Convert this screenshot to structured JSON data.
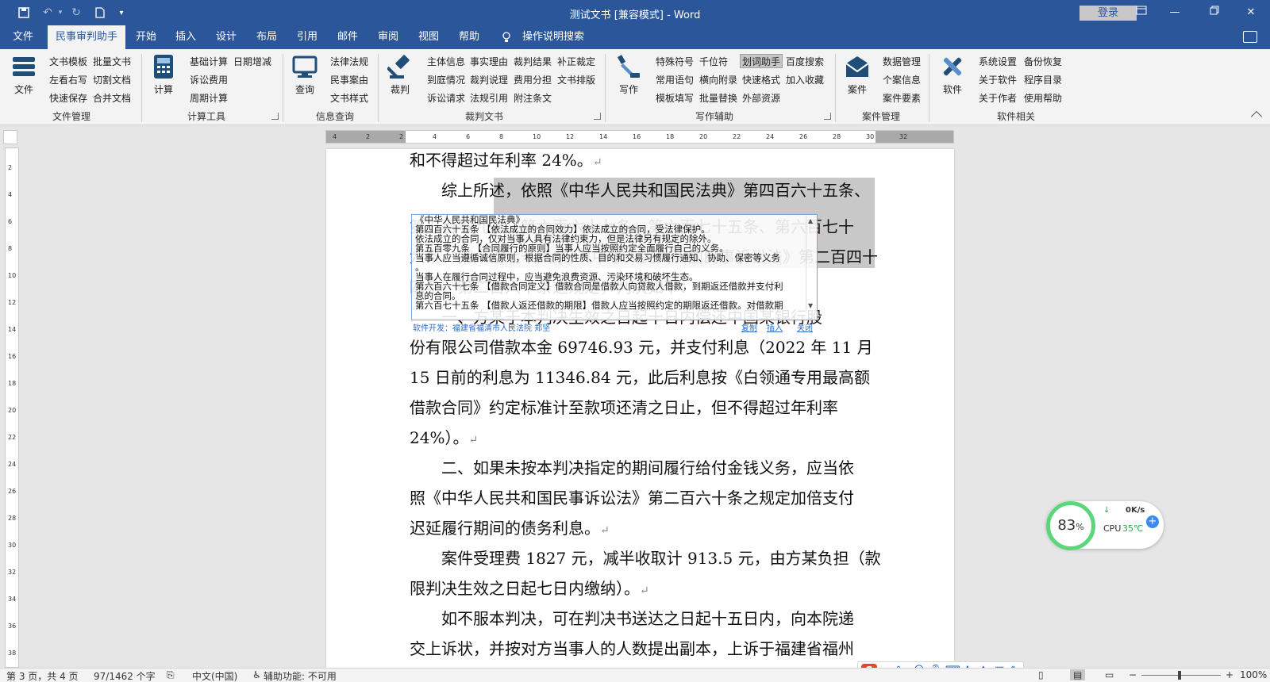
{
  "window": {
    "title": "测试文书 [兼容模式] - Word",
    "login": "登录"
  },
  "tabs": [
    "文件",
    "民事审判助手",
    "开始",
    "插入",
    "设计",
    "布局",
    "引用",
    "邮件",
    "审阅",
    "视图",
    "帮助"
  ],
  "tab_search": "操作说明搜索",
  "ribbon": {
    "big": {
      "file": "文件",
      "calc": "计算",
      "query": "查询",
      "judge": "裁判",
      "write": "写作",
      "case": "案件",
      "software": "软件"
    },
    "doc_mgmt": {
      "items": [
        "文书模板",
        "批量文书",
        "左看右写",
        "切割文档",
        "快速保存",
        "合并文档"
      ],
      "label": "文件管理"
    },
    "calc_tools": {
      "items": [
        "基础计算",
        "日期增减",
        "诉讼费用",
        "周期计算"
      ],
      "label": "计算工具"
    },
    "info_query": {
      "items": [
        "法律法规",
        "民事案由",
        "文书样式"
      ],
      "label": "信息查询"
    },
    "judgment": {
      "items": [
        "主体信息",
        "事实理由",
        "裁判结果",
        "补正裁定",
        "到庭情况",
        "裁判说理",
        "费用分担",
        "文书排版",
        "诉讼请求",
        "法规引用",
        "附注条文"
      ],
      "label": "裁判文书"
    },
    "writing": {
      "items": [
        "特殊符号",
        "千位符",
        "划词助手",
        "百度搜索",
        "常用语句",
        "横向附录",
        "快速格式",
        "加入收藏",
        "模板填写",
        "批量替换",
        "外部资源"
      ],
      "label": "写作辅助"
    },
    "case_mgmt": {
      "items": [
        "数据管理",
        "个案信息",
        "案件要素"
      ],
      "label": "案件管理"
    },
    "software_rel": {
      "items": [
        "系统设置",
        "备份恢复",
        "关于软件",
        "程序目录",
        "关于作者",
        "使用帮助"
      ],
      "label": "软件相关"
    }
  },
  "ruler": {
    "h": [
      "4",
      "2",
      "2",
      "4",
      "6",
      "8",
      "10",
      "12",
      "14",
      "16",
      "18",
      "20",
      "22",
      "24",
      "26",
      "28",
      "30",
      "32"
    ],
    "v": [
      "2",
      "4",
      "6",
      "8",
      "10",
      "12",
      "14",
      "16",
      "18",
      "20",
      "22",
      "24",
      "26",
      "28",
      "30",
      "32",
      "34",
      "36",
      "38"
    ]
  },
  "document": {
    "lines": [
      "和不得超过年利率 24%。",
      "　　综上所述，依照《中华人民共和国民法典》第四百六十五条、",
      "第五百零九条、第六百六十七条、第六百七十五条、第六百七十",
      "六条、第六百七十六条，《中华人民共和国民事诉讼法》第二百四十",
      "四条、第二百六十条之规定，判决如下：",
      "　　一、方某于本判决生效之日起十日内偿还中国某银行股",
      "份有限公司借款本金 69746.93 元，并支付利息（2022 年 11 月",
      "15 日前的利息为 11346.84 元，此后利息按《白领通专用最高额",
      "借款合同》约定标准计至款项还清之日止，但不得超过年利率",
      "24%）。",
      "　　二、如果未按本判决指定的期间履行给付金钱义务，应当依",
      "照《中华人民共和国民事诉讼法》第二百六十条之规定加倍支付",
      "迟延履行期间的债务利息。",
      "　　案件受理费 1827 元，减半收取计 913.5 元，由方某负担（款",
      "限判决生效之日起七日内缴纳）。",
      "　　如不服本判决，可在判决书送达之日起十五日内，向本院递",
      "交上诉状，并按对方当事人的人数提出副本，上诉于福建省福州"
    ]
  },
  "popup": {
    "lines": [
      "《中华人民共和国民法典》",
      "第四百六十五条 【依法成立的合同效力】依法成立的合同，受法律保护。",
      "依法成立的合同，仅对当事人具有法律约束力，但是法律另有规定的除外。",
      "第五百零九条 【合同履行的原则】当事人应当按照约定全面履行自己的义务。",
      "当事人应当遵循诚信原则，根据合同的性质、目的和交易习惯履行通知、协助、保密等义务",
      "。",
      "当事人在履行合同过程中，应当避免浪费资源、污染环境和破坏生态。",
      "第六百六十七条 【借款合同定义】借款合同是借款人向贷款人借款，到期返还借款并支付利",
      "息的合同。",
      "第六百七十五条 【借款人返还借款的期限】借款人应当按照约定的期限返还借款。对借款期"
    ],
    "footer": "软件开发：福建省福清市人民法院 郑坚",
    "copy": "复制",
    "insert": "插入",
    "close": "关闭"
  },
  "status": {
    "page": "第 3 页，共 4 页",
    "words": "97/1462 个字",
    "lang": "中文(中国)",
    "accessibility": "辅助功能: 不可用",
    "zoom": "100%"
  },
  "perf": {
    "percent": "83",
    "percent_sign": "%",
    "net": "0K/s",
    "cpu_label": "CPU",
    "cpu_temp": "35℃"
  },
  "ime": {
    "lang": "中",
    "punct": "°,"
  },
  "colors": {
    "title_blue": "#2b579a",
    "ribbon_bg": "#f3f3f3",
    "perf_green": "#5cd67a"
  }
}
